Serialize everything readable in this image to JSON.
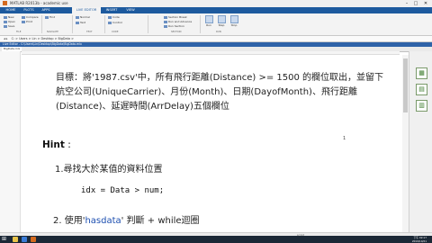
{
  "window": {
    "title": "MATLAB R2013b - academic use"
  },
  "tabs": [
    {
      "label": "HOME",
      "active": false
    },
    {
      "label": "PLOTS",
      "active": false
    },
    {
      "label": "APPS",
      "active": false
    },
    {
      "label": "LIVE EDITOR",
      "active": true
    },
    {
      "label": "INSERT",
      "active": false
    },
    {
      "label": "VIEW",
      "active": false
    }
  ],
  "ribbon": {
    "new": "New",
    "open": "Open",
    "save": "Save",
    "compare": "Compare",
    "print": "Print",
    "find": "Find",
    "normal": "Normal",
    "text": "Text",
    "code": "Code",
    "control": "Control",
    "section_file": "FILE",
    "section_navigate": "NAVIGATE",
    "section_text": "TEXT",
    "section_code": "CODE",
    "section_section": "SECTION",
    "section_run": "RUN",
    "section_break": "Section Break",
    "run_section": "Run Section",
    "run_and_advance": "Run and Advance",
    "run": "Run",
    "step": "Step",
    "stop": "Stop"
  },
  "address_bar": {
    "path": "C: > Users > Lin > Desktop > BigData >"
  },
  "editor_header": {
    "label": "Live Editor - C:\\Users\\Lin\\Desktop\\BigData\\BigData.mlx"
  },
  "file_tab": {
    "label": "BigData.mlx"
  },
  "content": {
    "paragraph": "目標：將'1987.csv'中，所有飛行距離(Distance) >= 1500 的欄位取出，並留下航空公司(UniqueCarrier)、月份(Month)、日期(DayofMonth)、飛行距離(Distance)、延遲時間(ArrDelay)五個欄位",
    "hint_label": "Hint",
    "hint_colon": " :",
    "item1": "1.尋找大於某值的資料位置",
    "code": "idx = Data > num;",
    "item2_prefix": "2.   使用'",
    "item2_keyword": "hasdata",
    "item2_suffix": "' 判斷 + while迴圈",
    "dot": "1"
  },
  "status_bar": {
    "position": "script"
  },
  "taskbar": {
    "time": "下午 02:17",
    "date": "2019/10/21"
  },
  "colors": {
    "accent": "#1d5a9e",
    "keyword": "#1d4fb0",
    "taskbar": "#1b2836"
  }
}
